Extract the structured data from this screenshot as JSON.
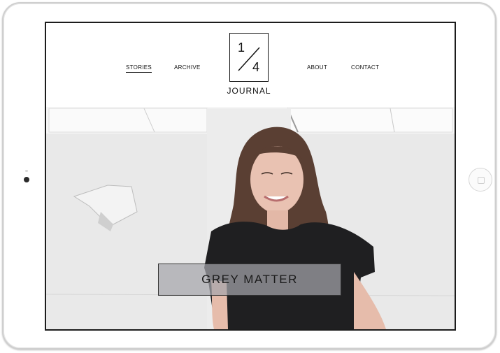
{
  "nav": {
    "left": [
      {
        "label": "STORIES",
        "active": true
      },
      {
        "label": "ARCHIVE",
        "active": false
      }
    ],
    "right": [
      {
        "label": "ABOUT"
      },
      {
        "label": "CONTACT"
      }
    ]
  },
  "logo": {
    "numerator": "1",
    "denominator": "4",
    "word": "JOURNAL"
  },
  "hero": {
    "caption": "GREY MATTER"
  },
  "colors": {
    "text": "#111111",
    "caption_bg": "#a5a5aa"
  }
}
